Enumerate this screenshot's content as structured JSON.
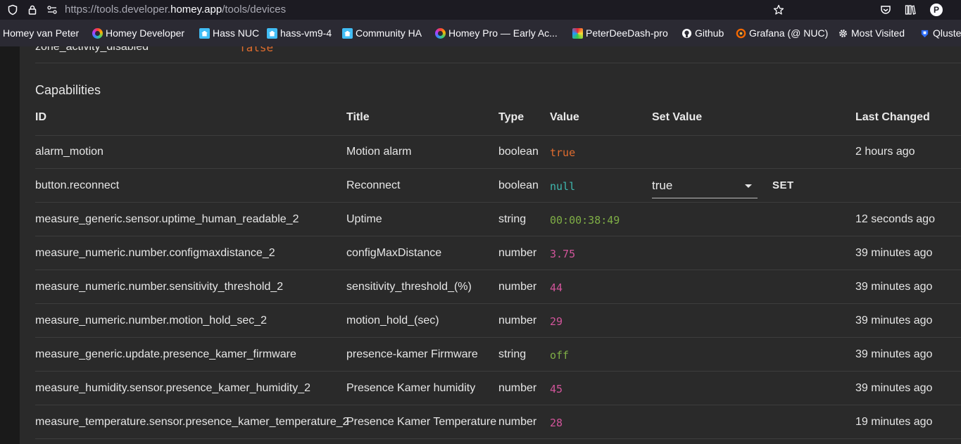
{
  "browser": {
    "url_prefix": "https://tools.developer.",
    "url_host": "homey.app",
    "url_path": "/tools/devices",
    "profile_initial": "P",
    "icons": [
      "shield-icon",
      "lock-icon",
      "permissions-icon",
      "star-icon",
      "pocket-icon",
      "library-icon",
      "avatar"
    ]
  },
  "bookmarks": [
    {
      "label": "Homey van Peter",
      "icon": "none"
    },
    {
      "label": "Homey Developer",
      "icon": "homey-ring-icon"
    },
    {
      "label": "Hass NUC",
      "icon": "home-assistant-icon"
    },
    {
      "label": "hass-vm9-4",
      "icon": "home-assistant-icon"
    },
    {
      "label": "Community HA",
      "icon": "home-assistant-icon"
    },
    {
      "label": "Homey Pro — Early Ac...",
      "icon": "homey-ring-icon"
    },
    {
      "label": "PeterDeeDash-pro",
      "icon": "dashboard-icon"
    },
    {
      "label": "Github",
      "icon": "github-icon"
    },
    {
      "label": "Grafana (@ NUC)",
      "icon": "grafana-icon"
    },
    {
      "label": "Most Visited",
      "icon": "gear-icon"
    },
    {
      "label": "Qluster",
      "icon": "qluster-icon"
    }
  ],
  "property": {
    "key": "zone_activity_disabled",
    "value": "false",
    "value_color": "#e06c2f"
  },
  "capabilities": {
    "title": "Capabilities",
    "headers": {
      "id": "ID",
      "title": "Title",
      "type": "Type",
      "value": "Value",
      "set_value": "Set Value",
      "last_changed": "Last Changed"
    },
    "rows": [
      {
        "id": "alarm_motion",
        "title": "Motion alarm",
        "type": "boolean",
        "value": "true",
        "value_color": "#e06c2f",
        "last_changed": "2 hours ago"
      },
      {
        "id": "button.reconnect",
        "title": "Reconnect",
        "type": "boolean",
        "value": "null",
        "value_color": "#3fb8af",
        "set_value": "true",
        "set_label": "SET",
        "last_changed": ""
      },
      {
        "id": "measure_generic.sensor.uptime_human_readable_2",
        "title": "Uptime",
        "type": "string",
        "value": "00:00:38:49",
        "value_color": "#7fae46",
        "last_changed": "12 seconds ago"
      },
      {
        "id": "measure_numeric.number.configmaxdistance_2",
        "title": "configMaxDistance",
        "type": "number",
        "value": "3.75",
        "value_color": "#d2559b",
        "last_changed": "39 minutes ago"
      },
      {
        "id": "measure_numeric.number.sensitivity_threshold_2",
        "title": "sensitivity_threshold_(%)",
        "type": "number",
        "value": "44",
        "value_color": "#d2559b",
        "last_changed": "39 minutes ago"
      },
      {
        "id": "measure_numeric.number.motion_hold_sec_2",
        "title": "motion_hold_(sec)",
        "type": "number",
        "value": "29",
        "value_color": "#d2559b",
        "last_changed": "39 minutes ago"
      },
      {
        "id": "measure_generic.update.presence_kamer_firmware",
        "title": "presence-kamer Firmware",
        "type": "string",
        "value": "off",
        "value_color": "#7fae46",
        "last_changed": "39 minutes ago"
      },
      {
        "id": "measure_humidity.sensor.presence_kamer_humidity_2",
        "title": "Presence Kamer humidity",
        "type": "number",
        "value": "45",
        "value_color": "#d2559b",
        "last_changed": "39 minutes ago"
      },
      {
        "id": "measure_temperature.sensor.presence_kamer_temperature_2",
        "title": "Presence Kamer Temperature",
        "type": "number",
        "value": "28",
        "value_color": "#d2559b",
        "last_changed": "19 minutes ago"
      }
    ]
  }
}
